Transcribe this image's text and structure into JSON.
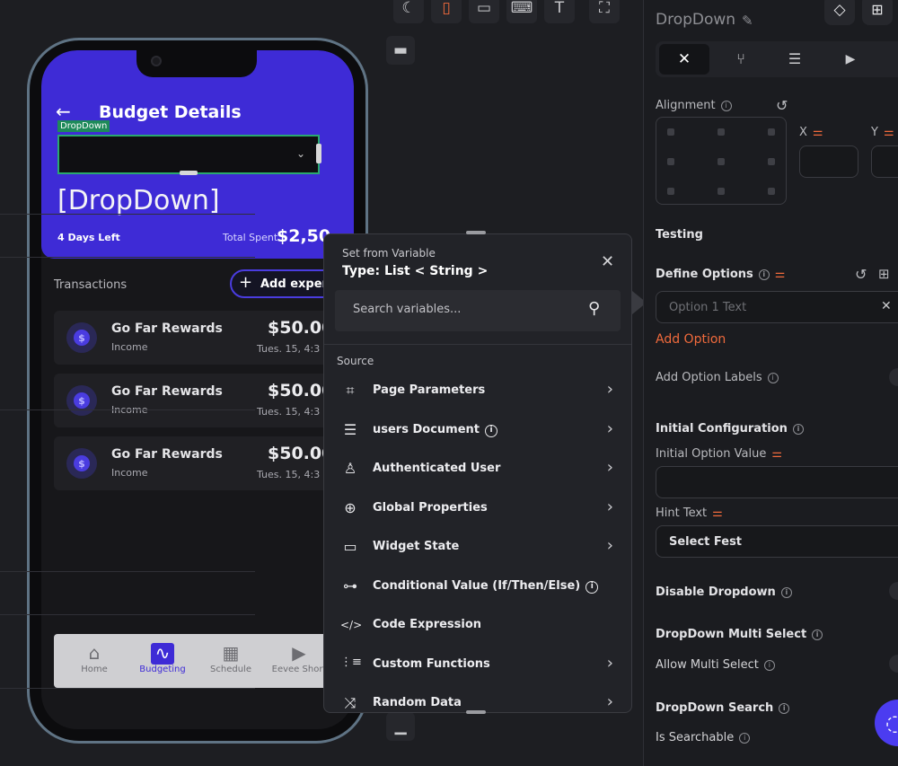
{
  "toolbar": {
    "icons": [
      "moon-icon",
      "phone-icon",
      "tablet-icon",
      "keyboard-icon",
      "text-size-icon",
      "transform-icon"
    ]
  },
  "phone": {
    "title": "Budget Details",
    "dropdown_tag": "DropDown",
    "dropdown_placeholder": "[DropDown]",
    "days_left": "4 Days Left",
    "total_spent_label": "Total Spent",
    "total_spent_value": "$2,50",
    "transactions_label": "Transactions",
    "add_expense_label": "Add expen",
    "transactions": [
      {
        "name": "Go Far Rewards",
        "type": "Income",
        "amount": "$50.00",
        "date": "Tues. 15, 4:3"
      },
      {
        "name": "Go Far Rewards",
        "type": "Income",
        "amount": "$50.00",
        "date": "Tues. 15, 4:3"
      },
      {
        "name": "Go Far Rewards",
        "type": "Income",
        "amount": "$50.00",
        "date": "Tues. 15, 4:3"
      }
    ],
    "nav": [
      {
        "label": "Home",
        "icon": "⌂"
      },
      {
        "label": "Budgeting",
        "icon": "∿"
      },
      {
        "label": "Schedule",
        "icon": "▦"
      },
      {
        "label": "Eevee Short",
        "icon": "▶"
      }
    ]
  },
  "popup": {
    "title": "Set from Variable",
    "type": "Type: List < String >",
    "search_placeholder": "Search variables...",
    "source_label": "Source",
    "sources": [
      {
        "label": "Page Parameters",
        "icon": "⌗",
        "chevron": true,
        "info": false
      },
      {
        "label": "users Document",
        "icon": "☰",
        "chevron": true,
        "info": true
      },
      {
        "label": "Authenticated User",
        "icon": "♙",
        "chevron": true,
        "info": false
      },
      {
        "label": "Global Properties",
        "icon": "⊕",
        "chevron": true,
        "info": false
      },
      {
        "label": "Widget State",
        "icon": "▭",
        "chevron": true,
        "info": false
      },
      {
        "label": "Conditional Value (If/Then/Else)",
        "icon": "⊶",
        "chevron": false,
        "info": true
      },
      {
        "label": "Code Expression",
        "icon": "</>",
        "chevron": false,
        "info": false
      },
      {
        "label": "Custom Functions",
        "icon": "⋮≡",
        "chevron": true,
        "info": false
      },
      {
        "label": "Random Data",
        "icon": "⤨",
        "chevron": true,
        "info": false
      }
    ]
  },
  "panel": {
    "widget_name": "DropDown",
    "alignment_label": "Alignment",
    "x_label": "X",
    "y_label": "Y",
    "testing_label": "Testing",
    "define_options_label": "Define Options",
    "option_placeholder": "Option 1 Text",
    "add_option_label": "Add Option",
    "add_option_labels_label": "Add Option Labels",
    "initial_config_label": "Initial Configuration",
    "initial_option_value_label": "Initial Option Value",
    "hint_text_label": "Hint Text",
    "hint_text_value": "Select Fest",
    "disable_dropdown_label": "Disable Dropdown",
    "multi_select_label": "DropDown Multi Select",
    "allow_multi_select_label": "Allow Multi Select",
    "search_label": "DropDown Search",
    "is_searchable_label": "Is Searchable"
  },
  "colors": {
    "accent": "#3e2bd6",
    "orange": "#f06a3c",
    "popup_bg": "#222328",
    "panel_bg": "#1b1c20"
  }
}
